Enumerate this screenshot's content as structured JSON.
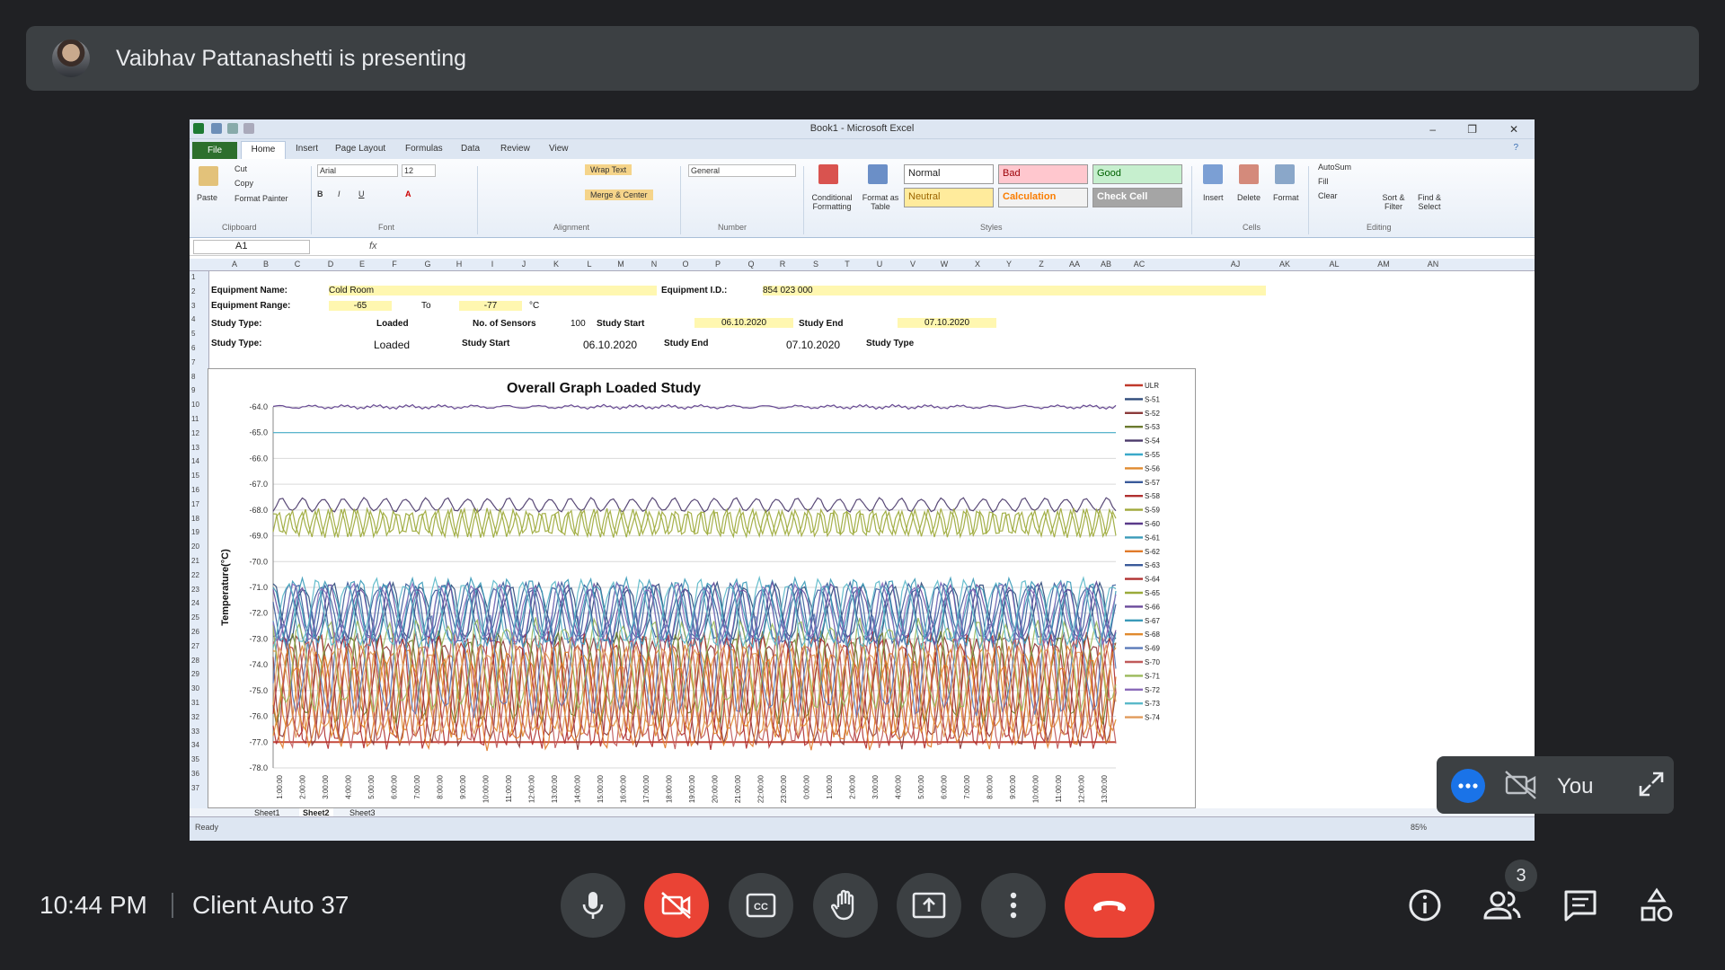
{
  "meet": {
    "presenting_text": "Vaibhav Pattanashetti is presenting",
    "time": "10:44 PM",
    "meeting_name": "Client Auto 37",
    "participants_count": "3",
    "self_label": "You",
    "colors": {
      "bg": "#202124",
      "bar": "#3c4043",
      "end_call": "#ea4335",
      "blue": "#1a73e8"
    }
  },
  "excel": {
    "window_title": "Book1 - Microsoft Excel",
    "tabs": [
      "File",
      "Home",
      "Insert",
      "Page Layout",
      "Formulas",
      "Data",
      "Review",
      "View"
    ],
    "clipboard": {
      "paste": "Paste",
      "cut": "Cut",
      "copy": "Copy",
      "format_painter": "Format Painter",
      "group": "Clipboard"
    },
    "font": {
      "name": "Arial",
      "size": "12",
      "group": "Font"
    },
    "alignment": {
      "wrap": "Wrap Text",
      "merge": "Merge & Center",
      "group": "Alignment"
    },
    "number": {
      "format": "General",
      "group": "Number"
    },
    "styles": {
      "cond": "Conditional Formatting",
      "table": "Format as Table",
      "normal": "Normal",
      "bad": "Bad",
      "good": "Good",
      "neutral": "Neutral",
      "calc": "Calculation",
      "check": "Check Cell",
      "group": "Styles"
    },
    "cells": {
      "insert": "Insert",
      "delete": "Delete",
      "format": "Format",
      "group": "Cells"
    },
    "editing": {
      "autosum": "AutoSum",
      "fill": "Fill",
      "clear": "Clear",
      "sort": "Sort & Filter",
      "find": "Find & Select",
      "group": "Editing"
    },
    "name_box": "A1",
    "columns": [
      "A",
      "B",
      "C",
      "D",
      "E",
      "F",
      "G",
      "H",
      "I",
      "J",
      "K",
      "L",
      "M",
      "N",
      "O",
      "P",
      "Q",
      "R",
      "S",
      "T",
      "U",
      "V",
      "W",
      "X",
      "Y",
      "Z",
      "AA",
      "AB",
      "AC",
      "AJ",
      "AK",
      "AL",
      "AM",
      "AN"
    ],
    "rows": [
      "1",
      "2",
      "3",
      "4",
      "5",
      "6",
      "7",
      "8",
      "9",
      "10",
      "11",
      "12",
      "13",
      "14",
      "15",
      "16",
      "17",
      "18",
      "19",
      "20",
      "21",
      "22",
      "23",
      "24",
      "25",
      "26",
      "27",
      "28",
      "29",
      "30",
      "31",
      "32",
      "33",
      "34",
      "35",
      "36",
      "37"
    ],
    "cells_data": {
      "eq_name_label": "Equipment Name:",
      "eq_name": "Cold Room",
      "eq_id_label": "Equipment I.D.:",
      "eq_id": "854 023 000",
      "eq_range_label": "Equipment Range:",
      "range_low": "-65",
      "range_to": "To",
      "range_high": "-77",
      "range_unit": "°C",
      "study_type_label": "Study Type:",
      "study_type": "Loaded",
      "sensors_label": "No. of Sensors",
      "sensors": "100",
      "study_start_label": "Study Start",
      "study_start": "06.10.2020",
      "study_end_label": "Study End",
      "study_end": "07.10.2020",
      "study_type_label2": "Study Type:",
      "study_type2": "Loaded",
      "study_start_label2": "Study Start",
      "study_start2": "06.10.2020",
      "study_end_label2": "Study End",
      "study_end2": "07.10.2020",
      "study_type_label3": "Study Type"
    },
    "sheets": [
      "Sheet1",
      "Sheet2",
      "Sheet3"
    ],
    "status": "Ready",
    "zoom": "85%"
  },
  "chart_data": {
    "type": "line",
    "title": "Overall Graph Loaded Study",
    "ylabel": "Temperature(°C)",
    "ylim": [
      -78.0,
      -64.0
    ],
    "yticks": [
      "-64.0",
      "-65.0",
      "-66.0",
      "-67.0",
      "-68.0",
      "-69.0",
      "-70.0",
      "-71.0",
      "-72.0",
      "-73.0",
      "-74.0",
      "-75.0",
      "-76.0",
      "-77.0",
      "-78.0"
    ],
    "legend_position": "right",
    "series": [
      {
        "name": "ULR",
        "color": "#c0392b",
        "values": [
          -77.0
        ]
      },
      {
        "name": "S-51",
        "color": "#2e4a7a",
        "values": [
          -72.0
        ]
      },
      {
        "name": "S-52",
        "color": "#8b3a3a",
        "values": [
          -75.0
        ]
      },
      {
        "name": "S-53",
        "color": "#6b7a2e",
        "values": [
          -74.5
        ]
      },
      {
        "name": "S-54",
        "color": "#4b3a6b",
        "values": [
          -67.8
        ]
      },
      {
        "name": "S-55",
        "color": "#3aa9c9",
        "values": [
          -65.0
        ]
      },
      {
        "name": "S-56",
        "color": "#e08a2e",
        "values": [
          -75.0
        ]
      },
      {
        "name": "S-57",
        "color": "#3a5a9a",
        "values": [
          -72.0
        ]
      },
      {
        "name": "S-58",
        "color": "#b03030",
        "values": [
          -75.0
        ]
      },
      {
        "name": "S-59",
        "color": "#a0a93a",
        "values": [
          -68.5
        ]
      },
      {
        "name": "S-60",
        "color": "#5a3a8a",
        "values": [
          -64.0
        ]
      },
      {
        "name": "S-61",
        "color": "#3a9ab9",
        "values": [
          -72.0
        ]
      },
      {
        "name": "S-62",
        "color": "#e07a2a",
        "values": [
          -75.5
        ]
      },
      {
        "name": "S-63",
        "color": "#3a5a9a",
        "values": [
          -72.0
        ]
      },
      {
        "name": "S-64",
        "color": "#b03030",
        "values": [
          -75.0
        ]
      },
      {
        "name": "S-65",
        "color": "#9aaa3a",
        "values": [
          -68.5
        ]
      },
      {
        "name": "S-66",
        "color": "#6a4a9a",
        "values": [
          -72.0
        ]
      },
      {
        "name": "S-67",
        "color": "#3a9ab9",
        "values": [
          -72.0
        ]
      },
      {
        "name": "S-68",
        "color": "#e08a2e",
        "values": [
          -75.0
        ]
      },
      {
        "name": "S-69",
        "color": "#5a7ab9",
        "values": [
          -74.0
        ]
      },
      {
        "name": "S-70",
        "color": "#c05a5a",
        "values": [
          -75.0
        ]
      },
      {
        "name": "S-71",
        "color": "#9ab95a",
        "values": [
          -74.0
        ]
      },
      {
        "name": "S-72",
        "color": "#8a6ab9",
        "values": [
          -72.0
        ]
      },
      {
        "name": "S-73",
        "color": "#5ab9c9",
        "values": [
          -72.0
        ]
      },
      {
        "name": "S-74",
        "color": "#e09a5a",
        "values": [
          -75.0
        ]
      }
    ],
    "x_tick_labels": [
      "1:00:00",
      "2:00:00",
      "3:00:00",
      "4:00:00",
      "5:00:00",
      "6:00:00",
      "7:00:00",
      "8:00:00",
      "9:00:00",
      "10:00:00",
      "11:00:00",
      "12:00:00",
      "13:00:00",
      "14:00:00",
      "15:00:00",
      "16:00:00",
      "17:00:00",
      "18:00:00",
      "19:00:00",
      "20:00:00",
      "21:00:00",
      "22:00:00",
      "23:00:00",
      "0:00:00",
      "1:00:00",
      "2:00:00",
      "3:00:00",
      "4:00:00",
      "5:00:00",
      "6:00:00",
      "7:00:00",
      "8:00:00",
      "9:00:00",
      "10:00:00",
      "11:00:00",
      "12:00:00",
      "13:00:00"
    ]
  }
}
